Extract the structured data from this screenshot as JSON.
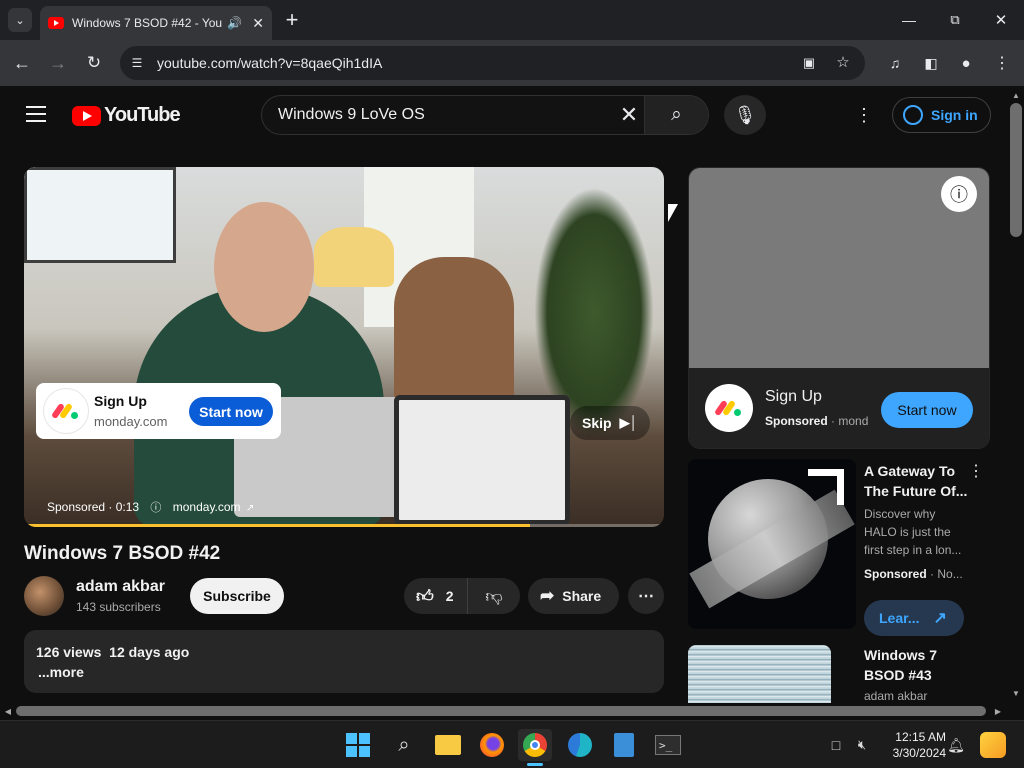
{
  "browser": {
    "tab_title": "Windows 7 BSOD #42 - You",
    "new_tab": "+",
    "url": "youtube.com/watch?v=8qaeQih1dIA"
  },
  "youtube": {
    "logo_text": "YouTube",
    "search_value": "Windows 9 LoVe OS",
    "sign_in": "Sign in"
  },
  "player_ad": {
    "cta_title": "Sign Up",
    "cta_domain": "monday.com",
    "cta_button": "Start now",
    "skip": "Skip",
    "sponsored_label": "Sponsored · 0:13",
    "sponsor_link": "monday.com",
    "progress": 0.79
  },
  "video": {
    "title": "Windows 7 BSOD #42",
    "channel": "adam akbar",
    "subscribers": "143 subscribers",
    "subscribe": "Subscribe",
    "likes": "2",
    "share": "Share",
    "description_stats": "126 views  12 days ago",
    "more": "...more"
  },
  "sidebar_ad": {
    "title": "Sign Up",
    "sponsored": "Sponsored",
    "domain": "mond",
    "button": "Start now"
  },
  "recommendations": [
    {
      "title_line1": "A Gateway To",
      "title_line2": "The Future Of...",
      "desc_line1": "Discover why",
      "desc_line2": "HALO is just the",
      "desc_line3": "first step in a lon...",
      "sponsored": "Sponsored",
      "domain": "No...",
      "button": "Lear..."
    },
    {
      "title_line1": "Windows 7",
      "title_line2": "BSOD #43",
      "channel": "adam akbar"
    }
  ],
  "taskbar": {
    "time": "12:15 AM",
    "date": "3/30/2024"
  },
  "colors": {
    "youtube_red": "#ff0000",
    "link_blue": "#3ea6ff",
    "monday_blue": "#0b5cd7"
  }
}
